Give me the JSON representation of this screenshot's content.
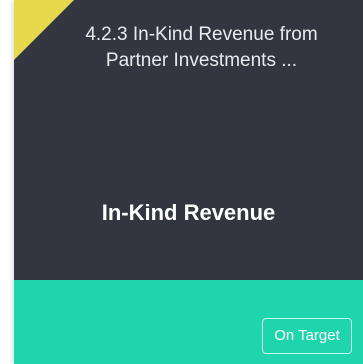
{
  "card": {
    "title": "4.2.3 In-Kind Revenue from Partner Investments ...",
    "metric_name": "In-Kind Revenue",
    "status": "On Target"
  },
  "colors": {
    "card_background": "#333641",
    "status_band": "#1fd5ad",
    "corner_flag": "#e6d84a",
    "title_text": "#e9eaee",
    "metric_text": "#ffffff"
  }
}
